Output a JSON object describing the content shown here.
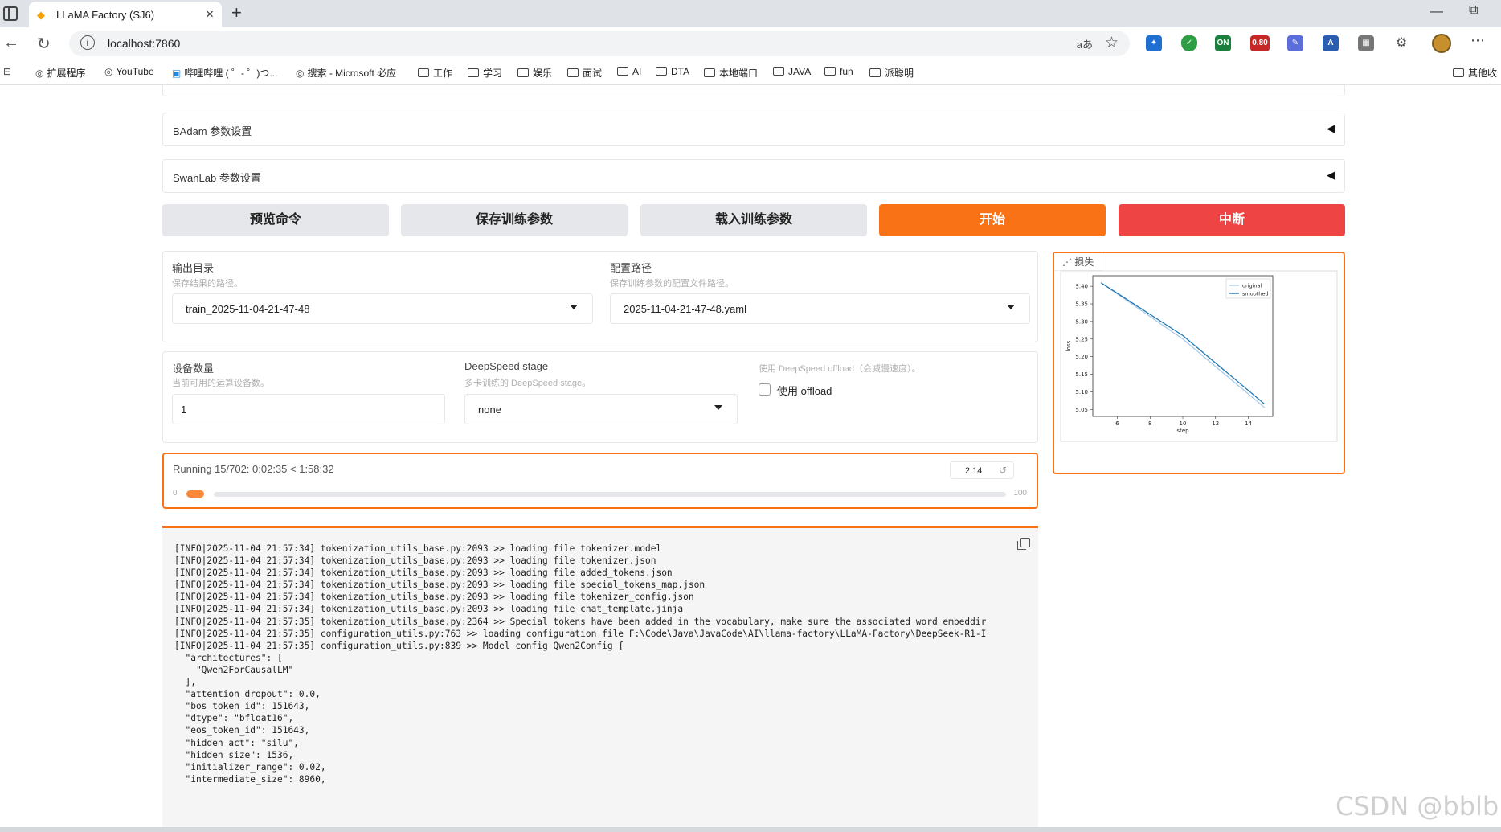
{
  "browser": {
    "tab_title": "LLaMA Factory (SJ6)",
    "url": "localhost:7860",
    "translate_label": "aあ",
    "ext_badges": [
      "ON",
      "0.80"
    ],
    "bookmarks": [
      {
        "label": "扩展程序",
        "icon": "extension-icon"
      },
      {
        "label": "YouTube",
        "icon": "globe-icon"
      },
      {
        "label": "哔哩哔哩 ( ゜- ゜)つ...",
        "icon": "bilibili-icon"
      },
      {
        "label": "搜索 - Microsoft 必应",
        "icon": "globe-icon"
      },
      {
        "label": "工作",
        "icon": "folder-icon"
      },
      {
        "label": "学习",
        "icon": "folder-icon"
      },
      {
        "label": "娱乐",
        "icon": "folder-icon"
      },
      {
        "label": "面试",
        "icon": "folder-icon"
      },
      {
        "label": "AI",
        "icon": "folder-icon"
      },
      {
        "label": "DTA",
        "icon": "folder-icon"
      },
      {
        "label": "本地端口",
        "icon": "folder-icon"
      },
      {
        "label": "JAVA",
        "icon": "folder-icon"
      },
      {
        "label": "fun",
        "icon": "folder-icon"
      },
      {
        "label": "派聪明",
        "icon": "folder-icon"
      }
    ],
    "other_bookmarks": "其他收"
  },
  "accordions": {
    "badam": "BAdam 参数设置",
    "swanlab": "SwanLab 参数设置"
  },
  "buttons": {
    "preview": "预览命令",
    "save": "保存训练参数",
    "load": "载入训练参数",
    "start": "开始",
    "abort": "中断"
  },
  "output": {
    "dir_label": "输出目录",
    "dir_info": "保存结果的路径。",
    "dir_value": "train_2025-11-04-21-47-48",
    "config_label": "配置路径",
    "config_info": "保存训练参数的配置文件路径。",
    "config_value": "2025-11-04-21-47-48.yaml"
  },
  "device": {
    "count_label": "设备数量",
    "count_info": "当前可用的运算设备数。",
    "count_value": "1",
    "ds_label": "DeepSpeed stage",
    "ds_info": "多卡训练的 DeepSpeed stage。",
    "ds_value": "none",
    "offload_info": "使用 DeepSpeed offload（会减慢速度）。",
    "offload_label": "使用 offload",
    "offload_checked": false
  },
  "progress": {
    "text": "Running 15/702: 0:02:35 < 1:58:32",
    "value": "2.14",
    "min": "0",
    "max": "100",
    "fraction": 0.0214
  },
  "plot": {
    "badge": "损失"
  },
  "chart_data": {
    "type": "line",
    "xlabel": "step",
    "ylabel": "loss",
    "xlim": [
      4.5,
      15.5
    ],
    "ylim": [
      5.03,
      5.43
    ],
    "xticks": [
      "6",
      "8",
      "10",
      "12",
      "14"
    ],
    "yticks": [
      "5.05",
      "5.10",
      "5.15",
      "5.20",
      "5.25",
      "5.30",
      "5.35",
      "5.40"
    ],
    "legend_position": "top-right",
    "series": [
      {
        "name": "original",
        "color": "#a6c8e6",
        "x": [
          5,
          10,
          15
        ],
        "y": [
          5.41,
          5.25,
          5.055
        ]
      },
      {
        "name": "smoothed",
        "color": "#1f77b4",
        "x": [
          5,
          10,
          15
        ],
        "y": [
          5.41,
          5.26,
          5.065
        ]
      }
    ]
  },
  "log": {
    "lines": [
      "[INFO|2025-11-04 21:57:34] tokenization_utils_base.py:2093 >> loading file tokenizer.model",
      "[INFO|2025-11-04 21:57:34] tokenization_utils_base.py:2093 >> loading file tokenizer.json",
      "[INFO|2025-11-04 21:57:34] tokenization_utils_base.py:2093 >> loading file added_tokens.json",
      "[INFO|2025-11-04 21:57:34] tokenization_utils_base.py:2093 >> loading file special_tokens_map.json",
      "[INFO|2025-11-04 21:57:34] tokenization_utils_base.py:2093 >> loading file tokenizer_config.json",
      "[INFO|2025-11-04 21:57:34] tokenization_utils_base.py:2093 >> loading file chat_template.jinja",
      "[INFO|2025-11-04 21:57:35] tokenization_utils_base.py:2364 >> Special tokens have been added in the vocabulary, make sure the associated word embeddir",
      "[INFO|2025-11-04 21:57:35] configuration_utils.py:763 >> loading configuration file F:\\Code\\Java\\JavaCode\\AI\\llama-factory\\LLaMA-Factory\\DeepSeek-R1-I",
      "[INFO|2025-11-04 21:57:35] configuration_utils.py:839 >> Model config Qwen2Config {",
      "  \"architectures\": [",
      "    \"Qwen2ForCausalLM\"",
      "  ],",
      "  \"attention_dropout\": 0.0,",
      "  \"bos_token_id\": 151643,",
      "  \"dtype\": \"bfloat16\",",
      "  \"eos_token_id\": 151643,",
      "  \"hidden_act\": \"silu\",",
      "  \"hidden_size\": 1536,",
      "  \"initializer_range\": 0.02,",
      "  \"intermediate_size\": 8960,"
    ]
  },
  "watermark": "CSDN @bblb"
}
